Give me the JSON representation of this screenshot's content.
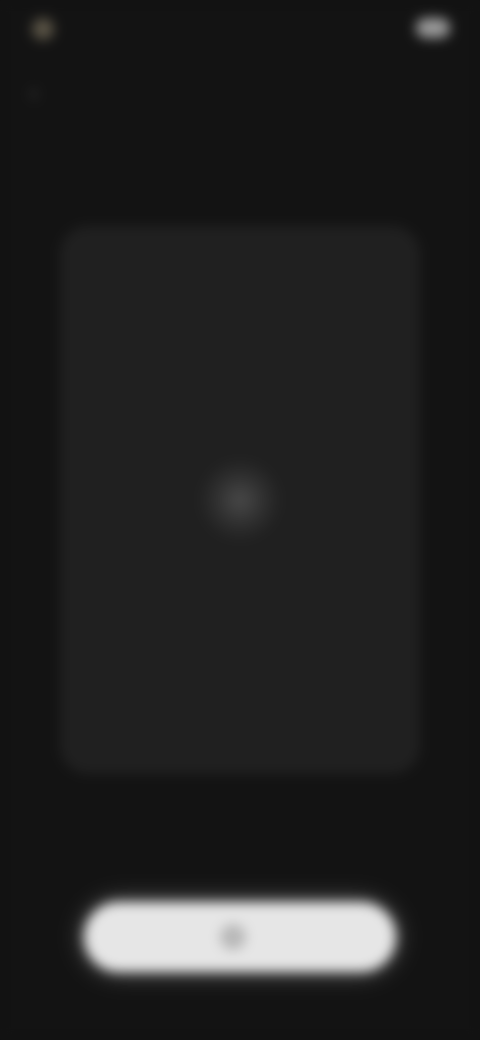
{
  "status_bar": {
    "time": "",
    "signal": "",
    "battery_icon": "battery-icon"
  },
  "header": {
    "back_icon": "chevron-left-icon",
    "title": ""
  },
  "preview": {
    "loader_icon": "spinner-icon"
  },
  "action": {
    "label": "",
    "icon": "action-icon"
  },
  "colors": {
    "background": "#131313",
    "card": "#202020",
    "button": "#e6e6e6"
  }
}
